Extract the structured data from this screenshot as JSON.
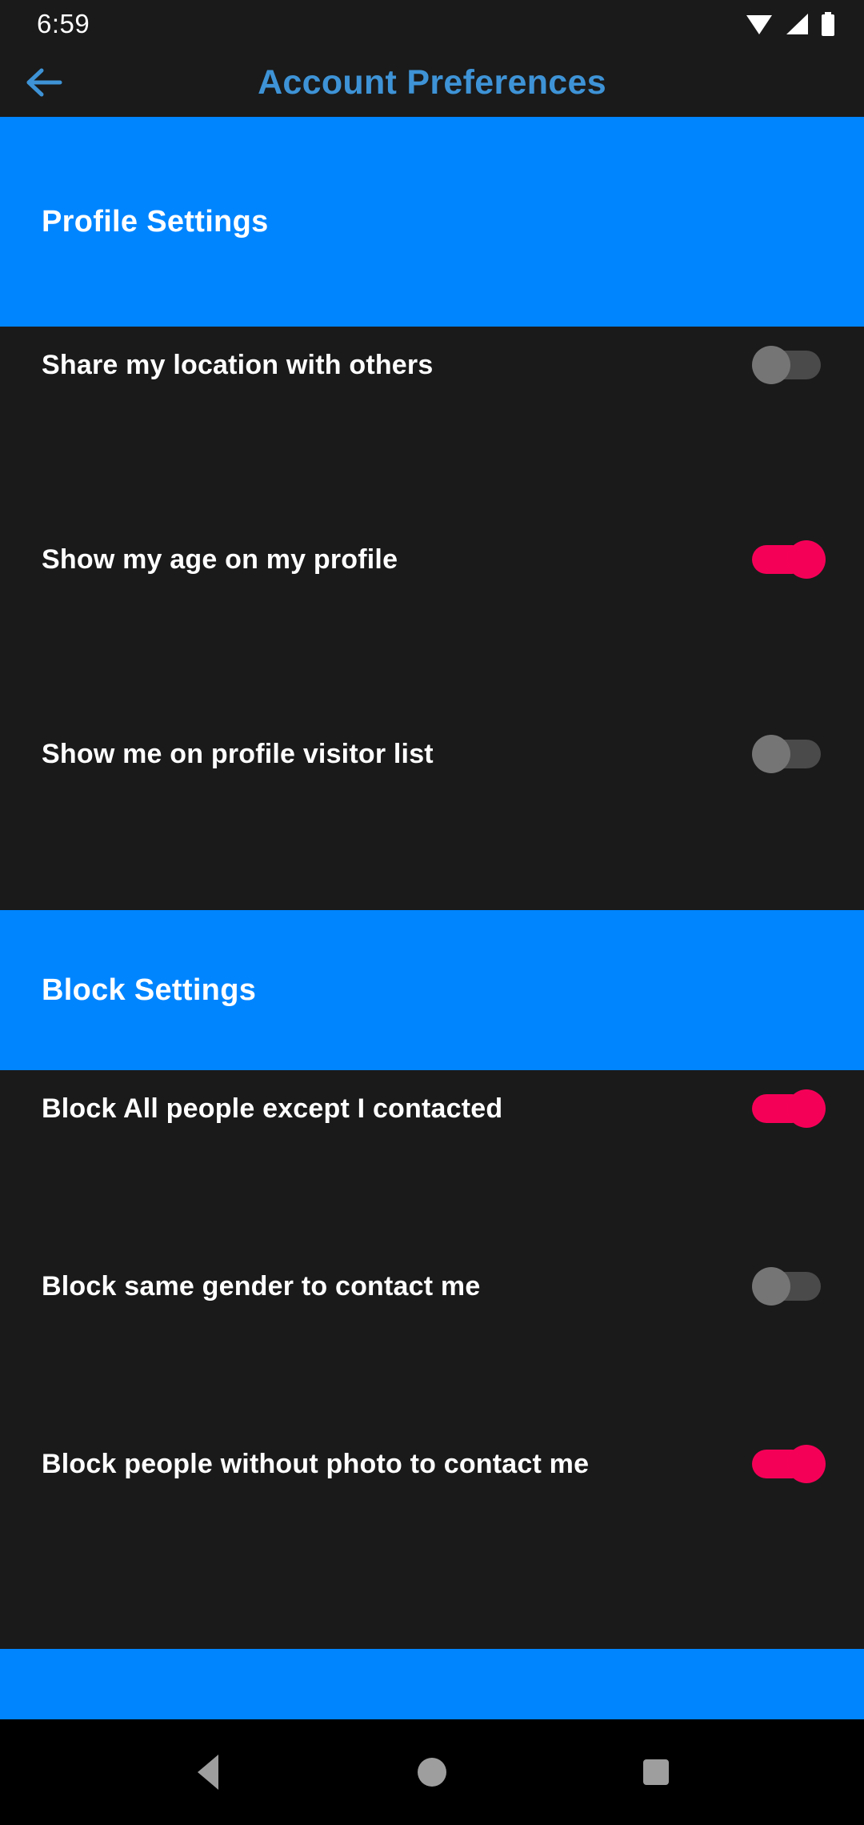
{
  "status_bar": {
    "clock": "6:59",
    "icons": [
      "wifi-icon",
      "cellular-signal-icon",
      "battery-icon"
    ]
  },
  "app_bar": {
    "back_icon": "arrow-back-icon",
    "title": "Account Preferences",
    "title_color": "#3e93d6"
  },
  "colors": {
    "section_band": "#0085ff",
    "background": "#1a1a1a",
    "toggle_on": "#f50057",
    "toggle_off_thumb": "#757575",
    "toggle_off_track": "#4a4a4a",
    "nav_icon": "#9e9e9e"
  },
  "sections": [
    {
      "title": "Profile Settings",
      "rows": [
        {
          "label": "Share my location with others",
          "toggle_state": "off"
        },
        {
          "label": "Show my age on my profile",
          "toggle_state": "on"
        },
        {
          "label": "Show me on profile visitor list",
          "toggle_state": "off"
        }
      ]
    },
    {
      "title": "Block Settings",
      "rows": [
        {
          "label": "Block All people except I contacted",
          "toggle_state": "on"
        },
        {
          "label": "Block same gender to contact me",
          "toggle_state": "off"
        },
        {
          "label": "Block people without photo to contact me",
          "toggle_state": "on"
        }
      ]
    }
  ],
  "nav_bar": {
    "back_label": "Back",
    "home_label": "Home",
    "recents_label": "Recents"
  }
}
